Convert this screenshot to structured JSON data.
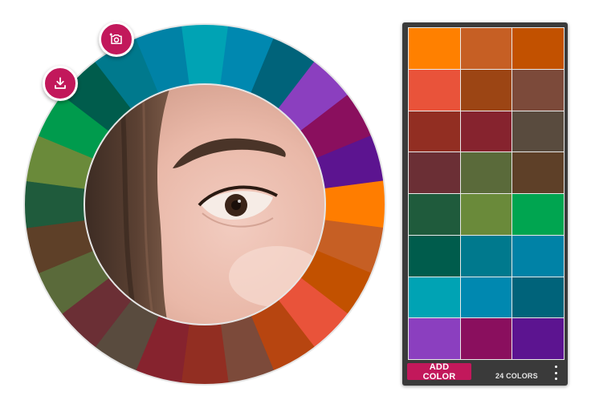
{
  "wheel": {
    "segment_colors": [
      "#00a3b4",
      "#0088b0",
      "#00637a",
      "#8b3fbf",
      "#8a0f5e",
      "#5c1490",
      "#ff7d00",
      "#c65f24",
      "#c25100",
      "#e9533a",
      "#b74510",
      "#7c4a3a",
      "#922e22",
      "#86232e",
      "#594b3e",
      "#6b2f35",
      "#5a6a3a",
      "#5e4028",
      "#1f5b3c",
      "#6a8a3a",
      "#009b4d",
      "#005c4c",
      "#00798d",
      "#0082a6"
    ],
    "ring_border_color": "#e6e6e6"
  },
  "buttons": {
    "camera_icon": "camera-plus-icon",
    "download_icon": "download-icon",
    "accent_color": "#c2185b"
  },
  "palette": {
    "swatches": [
      "#ff8000",
      "#c65f24",
      "#c25100",
      "#e9533a",
      "#9c4514",
      "#7c4a3a",
      "#922e22",
      "#86232e",
      "#594b3e",
      "#6b2f35",
      "#5a6a3a",
      "#5e4028",
      "#1f5b3c",
      "#6a8a3a",
      "#00a550",
      "#005c4c",
      "#00798d",
      "#0082a6",
      "#00a3b4",
      "#0088b0",
      "#00637a",
      "#8b3fbf",
      "#8a0f5e",
      "#5c1490"
    ],
    "add_color_label": "ADD COLOR",
    "count_label": "24 COLORS",
    "menu_icon": "more-vert-icon"
  }
}
